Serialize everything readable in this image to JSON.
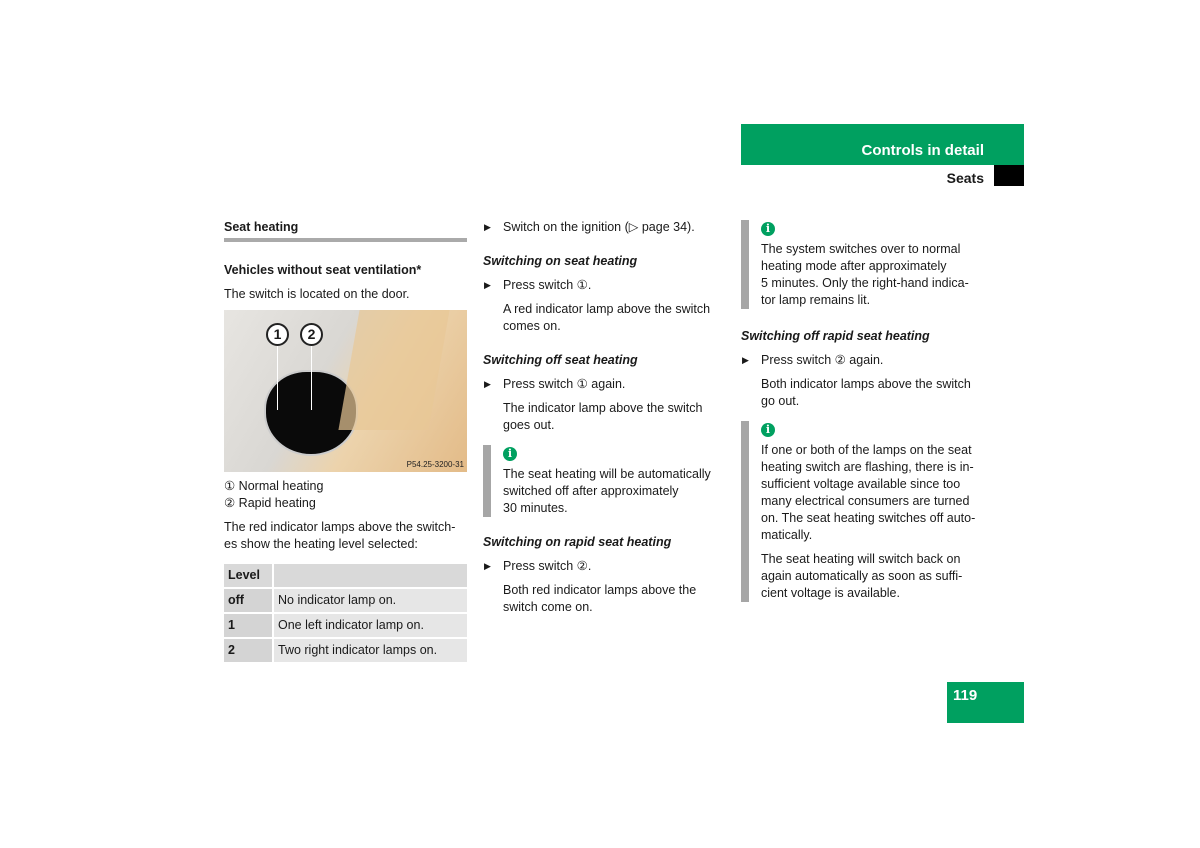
{
  "header": {
    "chapter": "Controls in detail",
    "section": "Seats",
    "page_number": "119",
    "accent_color": "#00a060"
  },
  "col1": {
    "title": "Seat heating",
    "subtitle": "Vehicles without seat ventilation*",
    "intro": "The switch is located on the door.",
    "image": {
      "callouts": [
        "1",
        "2"
      ],
      "caption_code": "P54.25-3200-31"
    },
    "legend": [
      "① Normal heating",
      "② Rapid heating"
    ],
    "text": "The red indicator lamps above the switch-\nes show the heating level selected:",
    "table": {
      "header": [
        "Level",
        ""
      ],
      "rows": [
        [
          "off",
          "No indicator lamp on."
        ],
        [
          "1",
          "One left indicator lamp on."
        ],
        [
          "2",
          "Two right indicator lamps on."
        ]
      ]
    }
  },
  "col2": {
    "step0": "Switch on the ignition (▷ page 34).",
    "h1": "Switching on seat heating",
    "s1": "Press switch ①.",
    "r1": "A red indicator lamp above the switch\ncomes on.",
    "h2": "Switching off seat heating",
    "s2": "Press switch ① again.",
    "r2": "The indicator lamp above the switch\ngoes out.",
    "info": "The seat heating will be automatically\nswitched off after approximately\n30 minutes.",
    "h3": "Switching on rapid seat heating",
    "s3": "Press switch ②.",
    "r3": "Both red indicator lamps above the\nswitch come on."
  },
  "col3": {
    "info1": "The system switches over to normal\nheating mode after approximately\n5 minutes. Only the right-hand indica-\ntor lamp remains lit.",
    "h1": "Switching off rapid seat heating",
    "s1": "Press switch ② again.",
    "r1": "Both indicator lamps above the switch\ngo out.",
    "info2a": "If one or both of the lamps on the seat\nheating switch are flashing, there is in-\nsufficient voltage available since too\nmany electrical consumers are turned\non. The seat heating switches off auto-\nmatically.",
    "info2b": "The seat heating will switch back on\nagain automatically as soon as suffi-\ncient voltage is available."
  },
  "info_icon": "i"
}
